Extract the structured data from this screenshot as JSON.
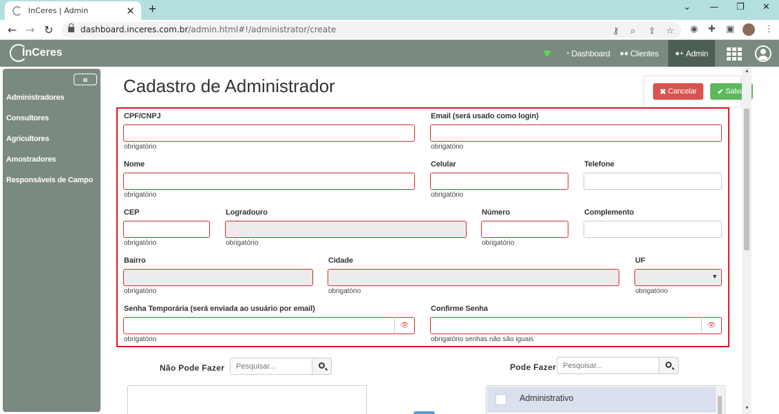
{
  "browser": {
    "tab_title": "InCeres | Admin",
    "url_host": "dashboard.inceres.com.br",
    "url_path": "/admin.html#!/administrator/create"
  },
  "app": {
    "logo_text": "InCeres",
    "nav": {
      "dashboard": "Dashboard",
      "clientes": "Clientes",
      "admin": "Admin"
    }
  },
  "sidebar": {
    "items": [
      "Administradores",
      "Consultores",
      "Agricultores",
      "Amostradores",
      "Responsáveis de Campo"
    ]
  },
  "page": {
    "title": "Cadastro de Administrador",
    "cancel_label": "Cancelar",
    "save_label": "Salvar"
  },
  "form": {
    "cpf_label": "CPF/CNPJ",
    "email_label": "Email (será usado como login)",
    "nome_label": "Nome",
    "celular_label": "Celular",
    "telefone_label": "Telefone",
    "cep_label": "CEP",
    "logradouro_label": "Logradouro",
    "numero_label": "Número",
    "complemento_label": "Complemento",
    "bairro_label": "Bairro",
    "cidade_label": "Cidade",
    "uf_label": "UF",
    "senha_label": "Senha Temporária (será enviada ao usuário por email)",
    "confirme_label": "Confirme Senha",
    "required_hint": "obrigatório",
    "mismatch_hint": "obrigatório senhas não são iguais"
  },
  "permissions": {
    "cannot_label": "Não Pode Fazer",
    "can_label": "Pode Fazer",
    "search_placeholder": "Pesquisar...",
    "can_items": [
      "Administrativo"
    ]
  }
}
